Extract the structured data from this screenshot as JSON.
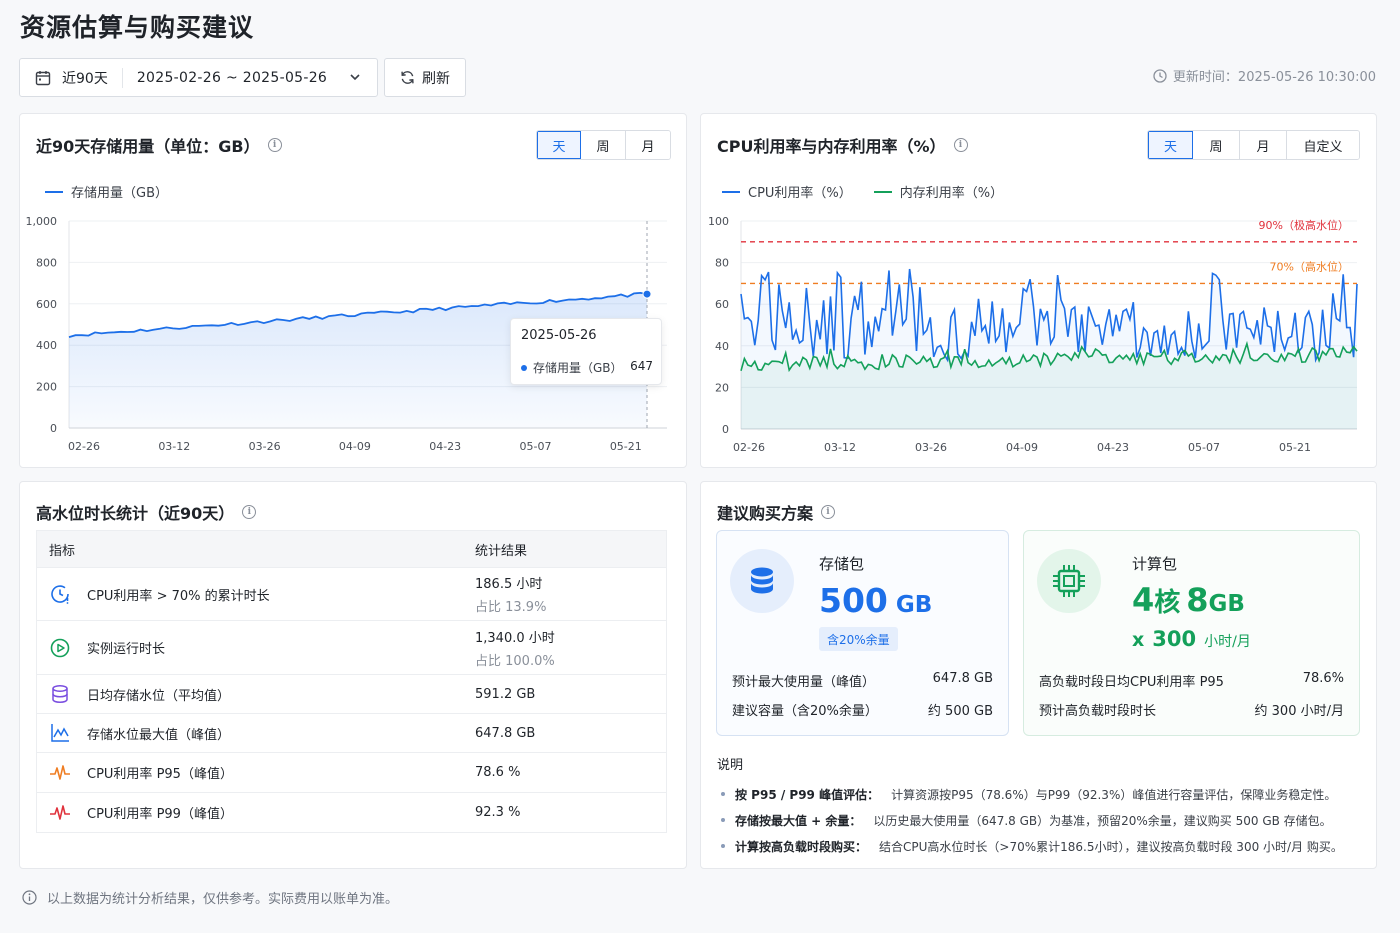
{
  "page": {
    "title": "资源估算与购买建议",
    "date_range_label": "近90天",
    "date_start": "2025-02-26",
    "date_sep": "~",
    "date_end": "2025-05-26",
    "refresh": "刷新",
    "updated": "更新时间：2025-05-26 10:30:00",
    "footer_note": "以上数据为统计分析结果，仅供参考。实际费用以账单为准。"
  },
  "storage_card": {
    "title": "近90天存储用量（单位：GB）",
    "tabs": [
      "天",
      "周",
      "月"
    ],
    "active_tab": "天",
    "legend": "存储用量（GB）",
    "tooltip_date": "2025-05-26",
    "tooltip_label": "存储用量（GB）",
    "tooltip_value": "647"
  },
  "cpu_card": {
    "title": "CPU利用率与内存利用率（%）",
    "tabs": [
      "天",
      "周",
      "月",
      "自定义"
    ],
    "active_tab": "天",
    "legend_cpu": "CPU利用率（%）",
    "legend_mem": "内存利用率（%）",
    "line_90": "90%（极高水位）",
    "line_70": "70%（高水位）"
  },
  "hw_card": {
    "title": "高水位时长统计（近90天）",
    "head_metric": "指标",
    "head_result": "统计结果",
    "rows": [
      {
        "icon": "clock-alert-icon",
        "metric": "CPU利用率 > 70% 的累计时长",
        "value": "186.5 小时",
        "sub": "占比 13.9%"
      },
      {
        "icon": "play-circle-icon",
        "metric": "实例运行时长",
        "value": "1,340.0 小时",
        "sub": "占比 100.0%"
      },
      {
        "icon": "database-icon",
        "metric": "日均存储水位（平均值）",
        "value": "591.2 GB",
        "sub": ""
      },
      {
        "icon": "area-chart-icon",
        "metric": "存储水位最大值（峰值）",
        "value": "647.8 GB",
        "sub": ""
      },
      {
        "icon": "pulse-orange-icon",
        "metric": "CPU利用率 P95（峰值）",
        "value": "78.6 %",
        "sub": ""
      },
      {
        "icon": "pulse-red-icon",
        "metric": "CPU利用率 P99（峰值）",
        "value": "92.3 %",
        "sub": ""
      }
    ]
  },
  "rec_card": {
    "title": "建议购买方案",
    "storage_pkg": {
      "name": "存储包",
      "amount": "500",
      "unit": "GB",
      "badge": "含20%余量",
      "k1": "预计最大使用量（峰值）",
      "v1": "647.8 GB",
      "k2": "建议容量（含20%余量）",
      "v2": "约 500 GB"
    },
    "compute_pkg": {
      "name": "计算包",
      "cores": "4",
      "cores_unit": "核",
      "mem": "8",
      "mem_unit": "GB",
      "x": "x",
      "hours": "300",
      "hours_unit": "小时/月",
      "k1": "高负载时段日均CPU利用率 P95",
      "v1": "78.6%",
      "k2": "预计高负载时段时长",
      "v2": "约 300 小时/月"
    },
    "notes_title": "说明",
    "notes": [
      {
        "k": "按 P95 / P99 峰值评估：",
        "v": "计算资源按P95（78.6%）与P99（92.3%）峰值进行容量评估，保障业务稳定性。"
      },
      {
        "k": "存储按最大值 + 余量：",
        "v": "以历史最大使用量（647.8 GB）为基准，预留20%余量，建议购买 500 GB 存储包。"
      },
      {
        "k": "计算按高负载时段购买：",
        "v": "结合CPU高水位时长（>70%累计186.5小时），建议按高负载时段 300 小时/月 购买。"
      }
    ]
  },
  "chart_data": [
    {
      "type": "area",
      "title": "近90天存储用量（单位：GB）",
      "series": [
        {
          "name": "存储用量（GB）",
          "color": "#1d6fe8"
        }
      ],
      "x_ticks": [
        "02-26",
        "03-12",
        "03-26",
        "04-09",
        "04-23",
        "05-07",
        "05-21"
      ],
      "y_ticks": [
        "0",
        "200",
        "400",
        "600",
        "800",
        "1,000"
      ],
      "ylim": [
        0,
        1000
      ],
      "start": 447,
      "end": 647,
      "points": 90,
      "grid": true,
      "legend": "top-left"
    },
    {
      "type": "line",
      "title": "CPU利用率与内存利用率（%）",
      "series": [
        {
          "name": "CPU利用率（%）",
          "color": "#1d6fe8",
          "approx_range": [
            33,
            77
          ]
        },
        {
          "name": "内存利用率（%）",
          "color": "#14a05a",
          "approx_range": [
            28,
            43
          ]
        }
      ],
      "x_ticks": [
        "02-26",
        "03-12",
        "03-26",
        "04-09",
        "04-23",
        "05-07",
        "05-21"
      ],
      "y_ticks": [
        "0",
        "20",
        "40",
        "60",
        "80",
        "100"
      ],
      "ylim": [
        0,
        100
      ],
      "reference_lines": [
        {
          "value": 90,
          "label": "90%（极高水位）",
          "color": "#e0323c"
        },
        {
          "value": 70,
          "label": "70%（高水位）",
          "color": "#ef7d22"
        }
      ],
      "grid": true,
      "legend": "top-left"
    }
  ]
}
